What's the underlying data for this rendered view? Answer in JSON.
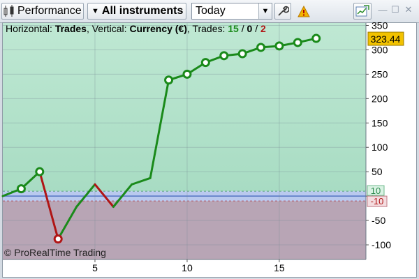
{
  "toolbar": {
    "title_label": "Performance",
    "instruments_label": "All instruments",
    "period_value": "Today",
    "icons": [
      "candlestick-icon",
      "dropdown-arrow-icon",
      "wrench-icon",
      "warning-icon",
      "chart-export-icon",
      "minimize-icon",
      "restore-icon",
      "close-icon"
    ]
  },
  "header": {
    "horizontal_label": "Horizontal:",
    "horizontal_value": "Trades",
    "vertical_label": ", Vertical:",
    "vertical_value": "Currency (€)",
    "trades_label": ", Trades:",
    "trades_win": "15",
    "sep1": "/",
    "trades_neutral": "0",
    "sep2": "/",
    "trades_loss": "2"
  },
  "current_value_badge": "323.44",
  "band_labels": {
    "upper": "10",
    "lower": "-10"
  },
  "copyright": "© ProRealTime Trading",
  "colors": {
    "gain": "#1a8a1a",
    "loss": "#b01515",
    "badge": "#f2c200",
    "upper_zone": "#a8dcc3",
    "lower_zone": "#b8a5b5",
    "band": "#b9c9ee"
  },
  "chart_data": {
    "type": "line",
    "x_ticks": [
      5,
      10,
      15
    ],
    "y_ticks": [
      350,
      300,
      250,
      200,
      150,
      100,
      50,
      0,
      -50,
      -100
    ],
    "xlim": [
      0,
      19.7
    ],
    "ylim": [
      -130,
      355
    ],
    "points": [
      {
        "x": 0,
        "y": 0,
        "marker": false
      },
      {
        "x": 1,
        "y": 15,
        "marker": true
      },
      {
        "x": 2,
        "y": 50,
        "marker": true
      },
      {
        "x": 3,
        "y": -88,
        "marker": true
      },
      {
        "x": 4,
        "y": -22,
        "marker": false
      },
      {
        "x": 5,
        "y": 24,
        "marker": false
      },
      {
        "x": 6,
        "y": -22,
        "marker": false
      },
      {
        "x": 7,
        "y": 24,
        "marker": false
      },
      {
        "x": 8,
        "y": 37,
        "marker": false
      },
      {
        "x": 9,
        "y": 238,
        "marker": true
      },
      {
        "x": 10,
        "y": 250,
        "marker": true
      },
      {
        "x": 11,
        "y": 274,
        "marker": true
      },
      {
        "x": 12,
        "y": 288,
        "marker": true
      },
      {
        "x": 13,
        "y": 292,
        "marker": true
      },
      {
        "x": 14,
        "y": 305,
        "marker": true
      },
      {
        "x": 15,
        "y": 308,
        "marker": true
      },
      {
        "x": 16,
        "y": 315,
        "marker": true
      },
      {
        "x": 17,
        "y": 323.44,
        "marker": true
      }
    ],
    "band": [
      -10,
      10
    ],
    "grid": true
  }
}
